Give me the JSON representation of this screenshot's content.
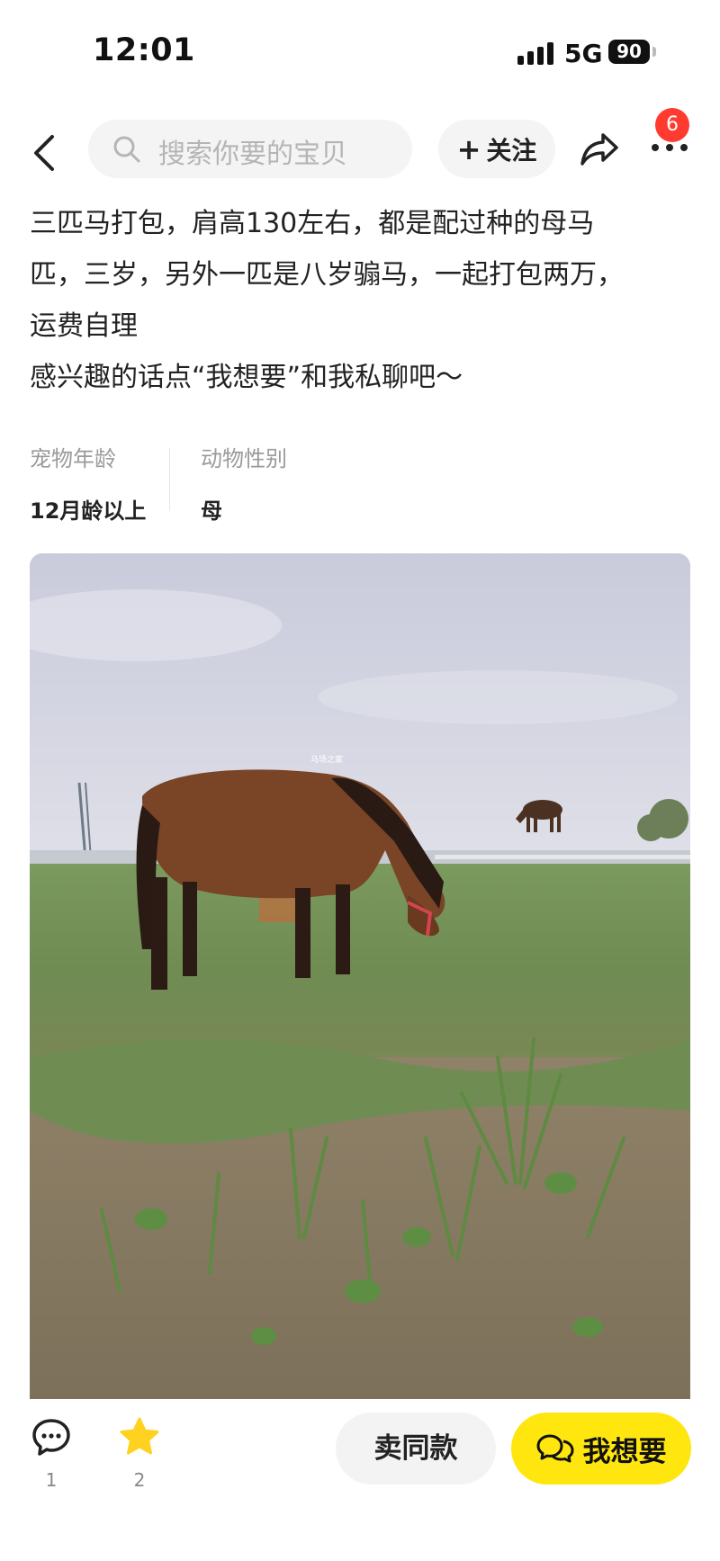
{
  "status": {
    "time": "12:01",
    "network": "5G",
    "battery": "90"
  },
  "nav": {
    "search_placeholder": "搜索你要的宝贝",
    "follow_label": "关注",
    "notification_count": "6"
  },
  "description": {
    "lines": [
      "三匹马打包，肩高130左右，都是配过种的母马",
      "匹，三岁，另外一匹是八岁骟马，一起打包两万，",
      "运费自理",
      "感兴趣的话点“我想要”和我私聊吧～"
    ]
  },
  "attributes": [
    {
      "key": "宠物年龄",
      "value": "12月龄以上"
    },
    {
      "key": "动物性别",
      "value": "母"
    }
  ],
  "photo": {
    "watermark": "马场之家"
  },
  "bottom_bar": {
    "comment_count": "1",
    "favorite_count": "2",
    "sell_same_label": "卖同款",
    "want_label": "我想要"
  },
  "colors": {
    "accent_yellow": "#ffe60f",
    "badge_red": "#ff3b30"
  }
}
